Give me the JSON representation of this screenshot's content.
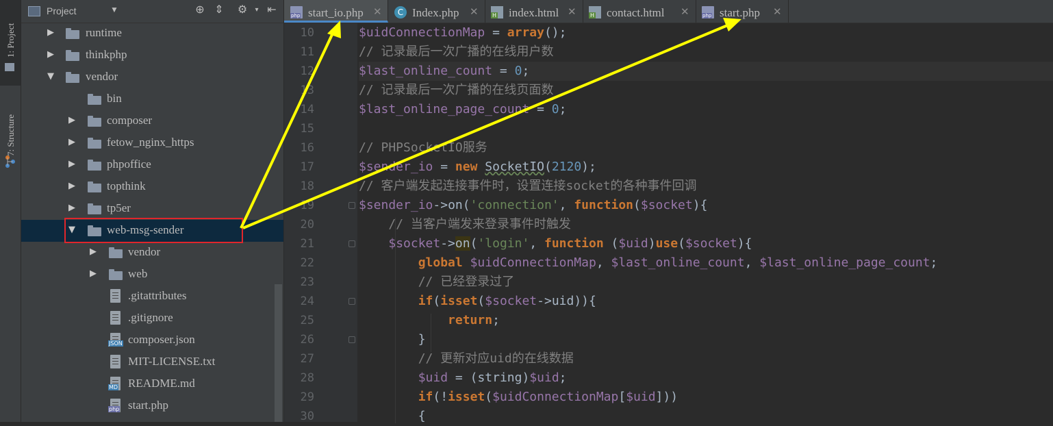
{
  "toolstrip": {
    "project_tab": "1: Project",
    "structure_tab": "7: Structure"
  },
  "project_panel": {
    "title": "Project",
    "tree": [
      {
        "label": "runtime",
        "kind": "folder",
        "level": 1,
        "expanded": false
      },
      {
        "label": "thinkphp",
        "kind": "folder",
        "level": 1,
        "expanded": false
      },
      {
        "label": "vendor",
        "kind": "folder",
        "level": 1,
        "expanded": true
      },
      {
        "label": "bin",
        "kind": "folder",
        "level": 2,
        "expanded": null
      },
      {
        "label": "composer",
        "kind": "folder",
        "level": 2,
        "expanded": false
      },
      {
        "label": "fetow_nginx_https",
        "kind": "folder",
        "level": 2,
        "expanded": false
      },
      {
        "label": "phpoffice",
        "kind": "folder",
        "level": 2,
        "expanded": false
      },
      {
        "label": "topthink",
        "kind": "folder",
        "level": 2,
        "expanded": false
      },
      {
        "label": "tp5er",
        "kind": "folder",
        "level": 2,
        "expanded": false
      },
      {
        "label": "web-msg-sender",
        "kind": "folder",
        "level": 2,
        "expanded": true,
        "selected": true
      },
      {
        "label": "vendor",
        "kind": "folder",
        "level": 3,
        "expanded": false
      },
      {
        "label": "web",
        "kind": "folder",
        "level": 3,
        "expanded": false
      },
      {
        "label": ".gitattributes",
        "kind": "text",
        "level": 3
      },
      {
        "label": ".gitignore",
        "kind": "text",
        "level": 3
      },
      {
        "label": "composer.json",
        "kind": "json",
        "tag": "JSON",
        "level": 3
      },
      {
        "label": "MIT-LICENSE.txt",
        "kind": "text",
        "level": 3
      },
      {
        "label": "README.md",
        "kind": "md",
        "tag": "MD",
        "level": 3
      },
      {
        "label": "start.php",
        "kind": "php",
        "tag": "php",
        "level": 3
      }
    ]
  },
  "tabs": [
    {
      "label": "start_io.php",
      "icon": "php-file-icon",
      "active": true
    },
    {
      "label": "Index.php",
      "icon": "class-icon",
      "active": false
    },
    {
      "label": "index.html",
      "icon": "html-file-icon",
      "active": false
    },
    {
      "label": "contact.html",
      "icon": "html-file-icon",
      "active": false
    },
    {
      "label": "start.php",
      "icon": "php-file-icon",
      "active": false
    }
  ],
  "tab_close_glyph": "✕",
  "editor": {
    "line_numbers": [
      "10",
      "11",
      "12",
      "13",
      "14",
      "15",
      "16",
      "17",
      "18",
      "19",
      "20",
      "21",
      "22",
      "23",
      "24",
      "25",
      "26",
      "27",
      "28",
      "29",
      "30"
    ],
    "lines": [
      "$uidConnectionMap = array();",
      "// 记录最后一次广播的在线用户数",
      "$last_online_count = 0;",
      "// 记录最后一次广播的在线页面数",
      "$last_online_page_count = 0;",
      "",
      "// PHPSocketIO服务",
      "$sender_io = new SocketIO(2120);",
      "// 客户端发起连接事件时，设置连接socket的各种事件回调",
      "$sender_io->on('connection', function($socket){",
      "    // 当客户端发来登录事件时触发",
      "    $socket->on('login', function ($uid)use($socket){",
      "        global $uidConnectionMap, $last_online_count, $last_online_page_count;",
      "        // 已经登录过了",
      "        if(isset($socket->uid)){",
      "            return;",
      "        }",
      "        // 更新对应uid的在线数据",
      "        $uid = (string)$uid;",
      "        if(!isset($uidConnectionMap[$uid]))",
      "        {"
    ]
  },
  "colors": {
    "arrow": "#ffff00",
    "highlight_box": "#e0262b",
    "selection": "#0d293e"
  }
}
